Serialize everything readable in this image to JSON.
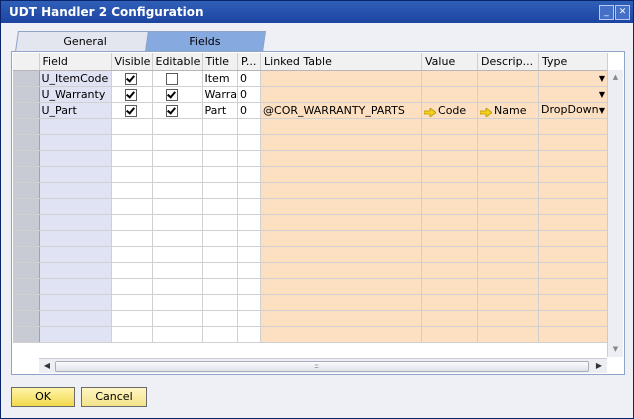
{
  "window": {
    "title": "UDT Handler 2 Configuration",
    "minimize": "_",
    "close": "✕"
  },
  "tabs": [
    {
      "label": "General"
    },
    {
      "label": "Fields"
    }
  ],
  "active_tab": "Fields",
  "columns": [
    "Field",
    "Visible",
    "Editable",
    "Title",
    "P...",
    "Linked Table",
    "Value",
    "Descrip...",
    "Type"
  ],
  "rows": [
    {
      "field": "U_ItemCode",
      "visible": true,
      "editable": false,
      "title": "Item",
      "p": "0",
      "linked_table": "",
      "value": "",
      "description": "",
      "type": ""
    },
    {
      "field": "U_Warranty",
      "visible": true,
      "editable": true,
      "title": "Warra",
      "p": "0",
      "linked_table": "",
      "value": "",
      "description": "",
      "type": ""
    },
    {
      "field": "U_Part",
      "visible": true,
      "editable": true,
      "title": "Part",
      "p": "0",
      "linked_table": "@COR_WARRANTY_PARTS",
      "value": "Code",
      "description": "Name",
      "type": "DropDown"
    }
  ],
  "buttons": {
    "ok": "OK",
    "cancel": "Cancel"
  },
  "colors": {
    "title_bar": "#1c44a0",
    "field_column": "#dfe3f3",
    "linked_columns": "#fde0c2",
    "ok_button": "#f2d94d"
  },
  "icons": {
    "link_arrow": "yellow-link-arrow-icon",
    "dropdown": "dropdown-arrow-icon"
  }
}
